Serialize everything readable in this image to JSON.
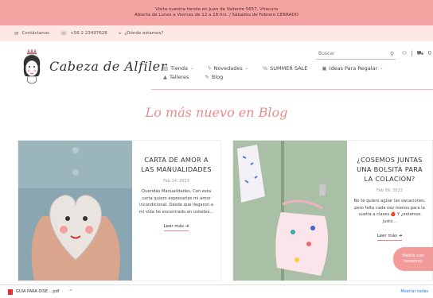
{
  "announcement": {
    "line1": "Visita nuestra tienda en Juan de Valiente 5657, Vitacura",
    "line2": "Abierta de Lunes a Viernes de 12 a 18 hrs. / Sábados de Febrero CERRADO"
  },
  "infobar": {
    "contact_label": "Contáctanos",
    "phone_label": "+56 2 23497628",
    "location_label": "¿Dónde estamos?"
  },
  "brand": {
    "name": "Cabeza de Alfiler"
  },
  "search": {
    "placeholder": "Buscar"
  },
  "cart_count": "0",
  "nav": {
    "items": [
      {
        "label": "Tienda",
        "icon": "store-icon",
        "has_caret": true
      },
      {
        "label": "Novedades",
        "icon": "bolt-icon",
        "has_caret": true
      },
      {
        "label": "SUMMER SALE",
        "icon": "percent-icon",
        "has_caret": false
      },
      {
        "label": "Ideas Para Regalar",
        "icon": "gift-icon",
        "has_caret": true
      }
    ],
    "items_row2": [
      {
        "label": "Talleres",
        "icon": "graduation-icon"
      },
      {
        "label": "Blog",
        "icon": "edit-icon"
      }
    ]
  },
  "headline": "Lo más nuevo en Blog",
  "posts": [
    {
      "title": "CARTA DE AMOR A LAS MANUALIDADES",
      "date": "Feb 14, 2023",
      "excerpt": "Queridas Manualidades, Con esta carta quiero expresarles mi amor incondicional. Desde que llegaron a mi vida he encontrado en ustedes...",
      "more": "Leer más ➔"
    },
    {
      "title": "¿COSEMOS JUNTAS UNA BOLSITA PARA LA COLACIÓN?",
      "date": "Feb 09, 2023",
      "excerpt": "No te quiero agüar las vacaciones, pero falta cada vez menos para la vuelta a clases 🍎 Y ¿estamos justo...",
      "more": "Leer más ➔"
    }
  ],
  "chat": {
    "label": "Habla con nosotros"
  },
  "downloads": {
    "file_name": "GUIA PARA DISE....pdf",
    "show_all": "Mostrar todas"
  },
  "colors": {
    "accent": "#f4a3a3",
    "accent_light": "#fde7e7",
    "headline": "#ef8a8a"
  }
}
